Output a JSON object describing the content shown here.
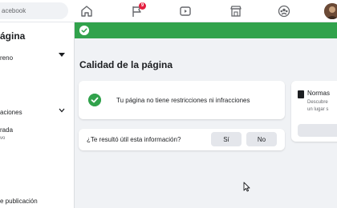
{
  "topbar": {
    "search_placeholder": "acebook",
    "notification_count": "9",
    "icons": [
      "home-icon",
      "flag-icon",
      "video-icon",
      "marketplace-icon",
      "groups-icon"
    ]
  },
  "sidebar": {
    "title": "ágina",
    "role": "reno",
    "items": [
      {
        "label": "aciones"
      },
      {
        "label": "rada",
        "sub": "vo"
      },
      {
        "label": "e publicación"
      }
    ]
  },
  "main": {
    "title": "Calidad de la página",
    "status_text": "Tu página no tiene restricciones ni infracciones",
    "feedback": {
      "question": "¿Te resultó útil esta información?",
      "yes_label": "Sí",
      "no_label": "No"
    },
    "norms": {
      "title": "Normas",
      "desc_line1": "Descubre",
      "desc_line2": "un lugar s"
    }
  },
  "colors": {
    "success_green": "#31a24c",
    "badge_red": "#e41e3f",
    "brand_blue": "#1877f2"
  }
}
